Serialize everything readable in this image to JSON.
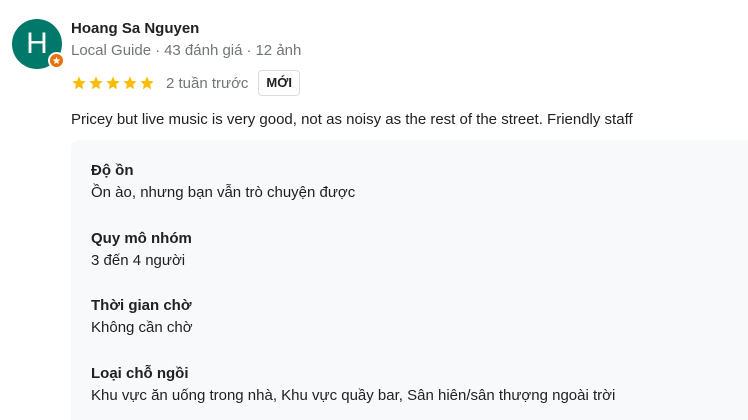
{
  "reviewer": {
    "name": "Hoang Sa Nguyen",
    "avatar_initial": "H",
    "avatar_color": "#00796b",
    "badge_icon": "local-guide-star-icon",
    "badge_color": "#e8710a",
    "guide_label": "Local Guide",
    "separator": "·",
    "reviews_count": "43 đánh giá",
    "photos_count": "12 ảnh"
  },
  "rating": {
    "stars": 5,
    "max_stars": 5,
    "star_color": "#fbbc04",
    "time": "2 tuần trước",
    "new_badge": "MỚI"
  },
  "review_text": "Pricey but live music is very good, not as noisy as the rest of the street. Friendly staff",
  "details": [
    {
      "label": "Độ ồn",
      "value": "Ồn ào, nhưng bạn vẫn trò chuyện được"
    },
    {
      "label": "Quy mô nhóm",
      "value": "3 đến 4 người"
    },
    {
      "label": "Thời gian chờ",
      "value": "Không cần chờ"
    },
    {
      "label": "Loại chỗ ngồi",
      "value": "Khu vực ăn uống trong nhà, Khu vực quầy bar, Sân hiên/sân thượng ngoài trời"
    }
  ]
}
